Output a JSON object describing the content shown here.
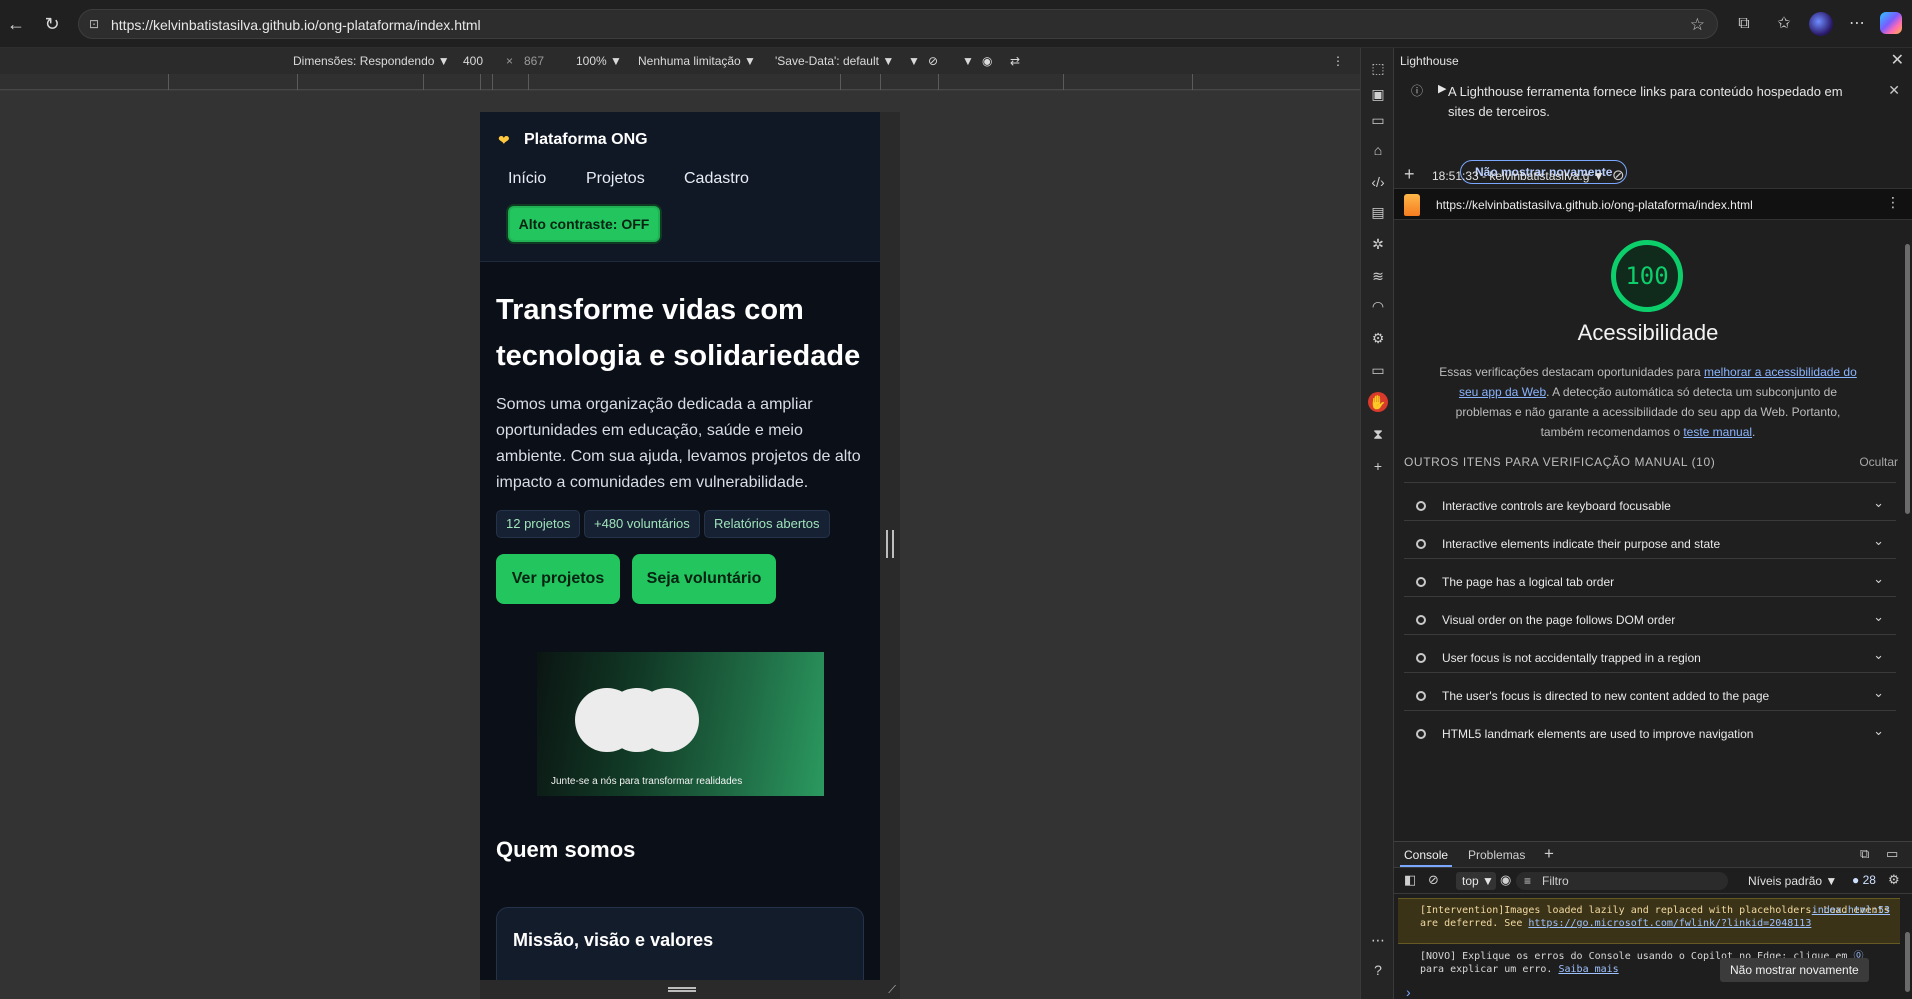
{
  "browser": {
    "url": "https://kelvinbatistasilva.github.io/ong-plataforma/index.html",
    "icons": [
      "back-icon",
      "refresh-icon",
      "lock-icon",
      "star-icon",
      "extensions-icon",
      "favorites-icon",
      "profile-avatar",
      "more-icon",
      "copilot-icon"
    ]
  },
  "device_toolbar": {
    "dimensions_label": "Dimensões: Respondendo",
    "width": "400",
    "times": "×",
    "height": "867",
    "zoom": "100%",
    "throttling": "Nenhuma limitação",
    "save_data": "'Save-Data': default"
  },
  "site": {
    "brand": "Plataforma ONG",
    "nav": [
      "Início",
      "Projetos",
      "Cadastro"
    ],
    "contrast_button": "Alto contraste: OFF",
    "hero_title": "Transforme vidas com tecnologia e solidariedade",
    "hero_text": "Somos uma organização dedicada a ampliar oportunidades em educação, saúde e meio ambiente. Com sua ajuda, levamos projetos de alto impacto a comunidades em vulnerabilidade.",
    "pills": [
      "12 projetos",
      "+480 voluntários",
      "Relatórios abertos"
    ],
    "cta_primary": "Ver projetos",
    "cta_secondary": "Seja voluntário",
    "figure_caption": "Junte-se a nós para transformar realidades",
    "section_title": "Quem somos",
    "card_title": "Missão, visão e valores"
  },
  "devtools": {
    "panel_title": "Lighthouse",
    "notice": "A Lighthouse ferramenta fornece links para conteúdo hospedado em sites de terceiros.",
    "notice_button": "Não mostrar novamente",
    "run_label": "18:51:33 - kelvinbatistasilva.g",
    "report_url": "https://kelvinbatistasilva.github.io/ong-plataforma/index.html",
    "score": "100",
    "category": "Acessibilidade",
    "desc_1": "Essas verificações destacam oportunidades para ",
    "desc_link_1": "melhorar a acessibilidade do seu app da Web",
    "desc_2": ". A detecção automática só detecta um subconjunto de problemas e não garante a acessibilidade do seu app da Web. Portanto, também recomendamos o ",
    "desc_link_2": "teste manual",
    "desc_3": ".",
    "manual_header": "OUTROS ITENS PARA VERIFICAÇÃO MANUAL (10)",
    "hide_label": "Ocultar",
    "manual_items": [
      "Interactive controls are keyboard focusable",
      "Interactive elements indicate their purpose and state",
      "The page has a logical tab order",
      "Visual order on the page follows DOM order",
      "User focus is not accidentally trapped in a region",
      "The user's focus is directed to new content added to the page",
      "HTML5 landmark elements are used to improve navigation"
    ],
    "colors": {
      "score_green": "#0cce6b",
      "site_accent": "#22c55e"
    }
  },
  "console": {
    "tabs": [
      "Console",
      "Problemas"
    ],
    "context": "top",
    "filter_placeholder": "Filtro",
    "levels": "Níveis padrão",
    "issues_count": "28",
    "warn_text": "[Intervention]Images loaded lazily and replaced with placeholders. Load events are deferred. See ",
    "warn_link": "https://go.microsoft.com/fwlink/?linkid=2048113",
    "warn_source": "index.html:53",
    "copilot_text_1": "[NOVO] Explique os erros do Console usando o Copilot no Edge: clique em ",
    "copilot_text_2": " para explicar um erro. ",
    "copilot_link": "Saiba mais",
    "tooltip": "Não mostrar novamente"
  }
}
